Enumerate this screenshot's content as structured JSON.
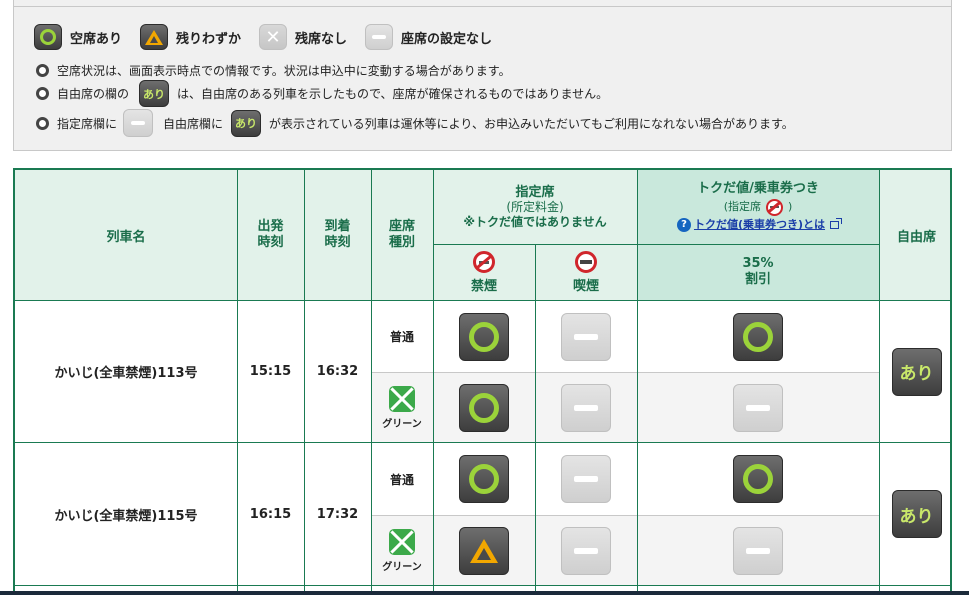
{
  "legend": {
    "items": [
      {
        "type": "available",
        "label": "空席あり"
      },
      {
        "type": "few",
        "label": "残りわずか"
      },
      {
        "type": "none",
        "label": "残席なし"
      },
      {
        "type": "unset",
        "label": "座席の設定なし"
      }
    ],
    "note1": "空席状況は、画面表示時点での情報です。状況は申込中に変動する場合があります。",
    "note2_pre": "自由席の欄の",
    "note2_badge": "あり",
    "note2_post": "は、自由席のある列車を示したもので、座席が確保されるものではありません。",
    "note3_pre": "指定席欄に",
    "note3_mid": "自由席欄に",
    "note3_badge": "あり",
    "note3_post": "が表示されている列車は運休等により、お申込みいただいてもご利用になれない場合があります。"
  },
  "table": {
    "headers": {
      "train": "列車名",
      "depart_1": "出発",
      "depart_2": "時刻",
      "arrive_1": "到着",
      "arrive_2": "時刻",
      "seat_1": "座席",
      "seat_2": "種別",
      "reserved_title": "指定席",
      "reserved_sub": "(所定料金)",
      "reserved_note": "※トクだ値ではありません",
      "nonsmoking": "禁煙",
      "smoking": "喫煙",
      "toku_title": "トクだ値/乗車券つき",
      "toku_sub_pre": "(指定席",
      "toku_sub_post": ")",
      "toku_link": "トクだ値(乗車券つき)とは",
      "discount_1": "35%",
      "discount_2": "割引",
      "unreserved": "自由席"
    },
    "trains": [
      {
        "name": "かいじ(全車禁煙)113号",
        "depart": "15:15",
        "arrive": "16:32",
        "rows": [
          {
            "class": "普通",
            "nonsmoking": "available",
            "smoking": "unset",
            "toku": "available"
          },
          {
            "class": "グリーン",
            "nonsmoking": "available",
            "smoking": "unset",
            "toku": "unset"
          }
        ],
        "unreserved": "あり"
      },
      {
        "name": "かいじ(全車禁煙)115号",
        "depart": "16:15",
        "arrive": "17:32",
        "rows": [
          {
            "class": "普通",
            "nonsmoking": "available",
            "smoking": "unset",
            "toku": "available"
          },
          {
            "class": "グリーン",
            "nonsmoking": "few",
            "smoking": "unset",
            "toku": "unset"
          }
        ],
        "unreserved": "あり"
      }
    ]
  },
  "colors": {
    "accent_green": "#1a7a52",
    "available_ring": "#9bd33a",
    "few_triangle": "#f2a700",
    "header_bg": "#e2f2ea",
    "link_blue": "#1a3ea8"
  }
}
